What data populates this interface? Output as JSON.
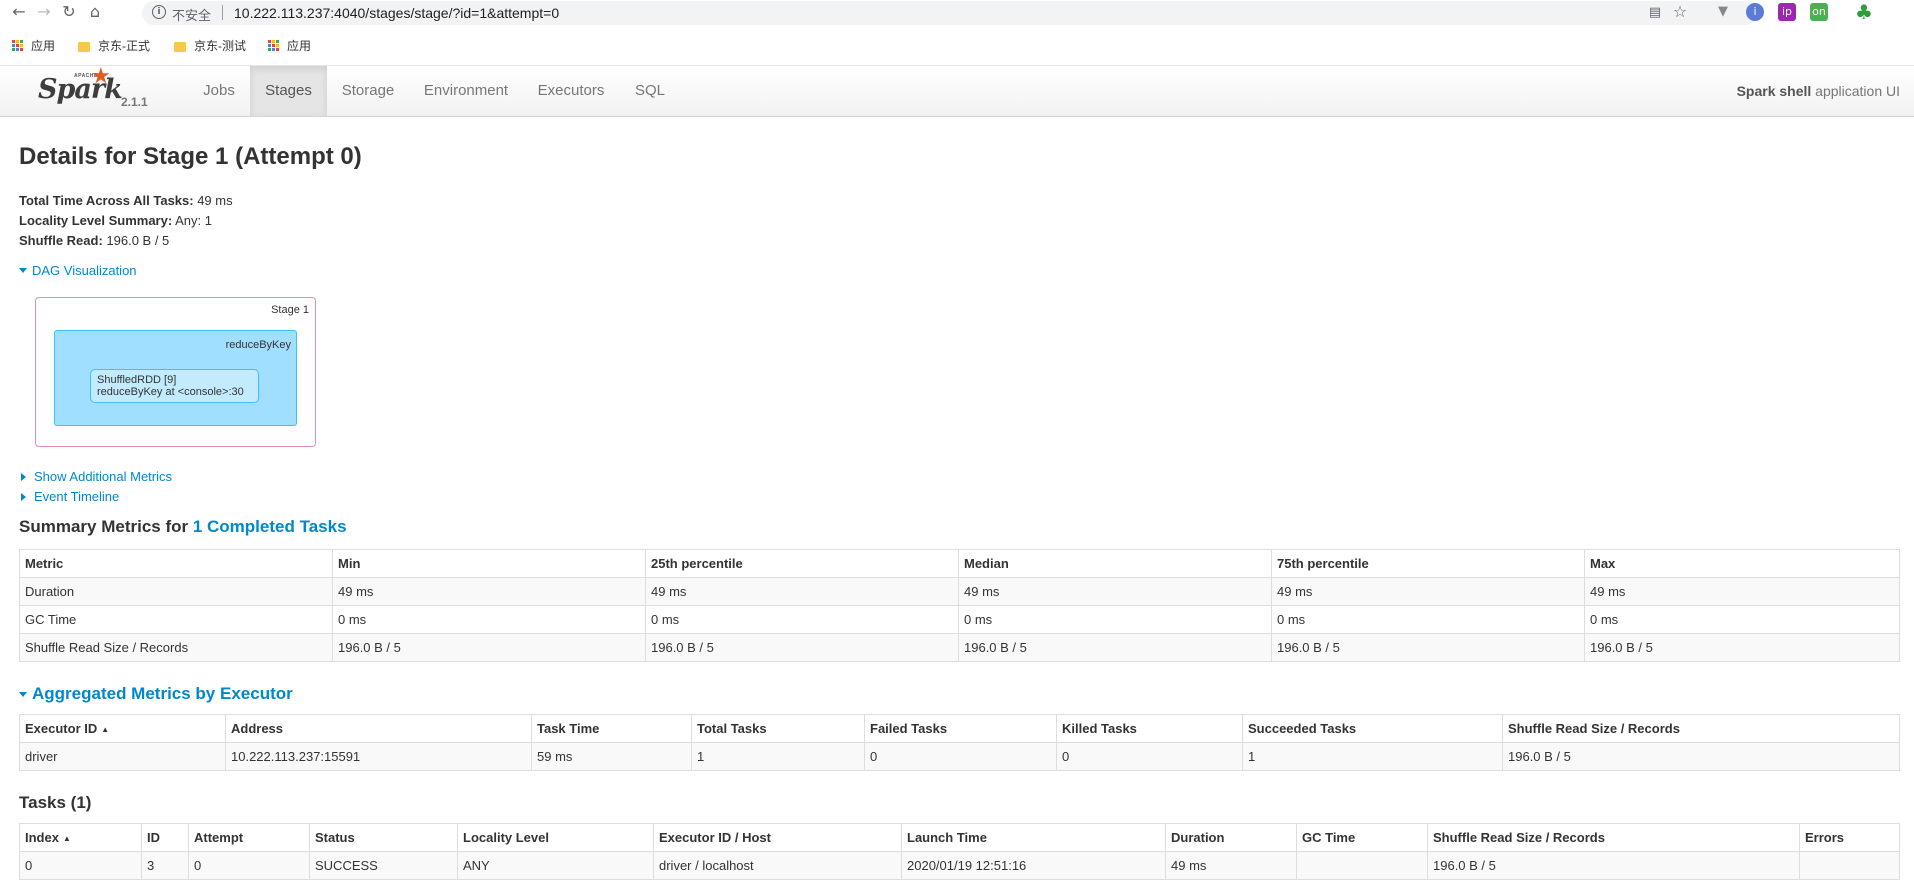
{
  "browser": {
    "insecure_label": "不安全",
    "url": "10.222.113.237:4040/stages/stage/?id=1&attempt=0",
    "bookmarks": [
      "应用",
      "京东-正式",
      "京东-测试",
      "应用"
    ]
  },
  "navbar": {
    "brand_apache": "APACHE",
    "brand_name": "Spark",
    "version": "2.1.1",
    "tabs": [
      "Jobs",
      "Stages",
      "Storage",
      "Environment",
      "Executors",
      "SQL"
    ],
    "active_tab": "Stages",
    "app_name_bold": "Spark shell",
    "app_name_suffix": " application UI"
  },
  "page": {
    "title": "Details for Stage 1 (Attempt 0)",
    "total_time_label": "Total Time Across All Tasks:",
    "total_time_value": " 49 ms",
    "locality_label": "Locality Level Summary:",
    "locality_value": " Any: 1",
    "shuffle_label": "Shuffle Read:",
    "shuffle_value": " 196.0 B / 5",
    "dag_toggle": "DAG Visualization",
    "additional_metrics": "Show Additional Metrics",
    "event_timeline": "Event Timeline"
  },
  "dag": {
    "stage_label": "Stage 1",
    "cluster_label": "reduceByKey",
    "node_line1": "ShuffledRDD [9]",
    "node_line2": "reduceByKey at <console>:30"
  },
  "summary": {
    "heading_prefix": "Summary Metrics for ",
    "heading_link": "1 Completed Tasks",
    "columns": [
      "Metric",
      "Min",
      "25th percentile",
      "Median",
      "75th percentile",
      "Max"
    ],
    "rows": [
      [
        "Duration",
        "49 ms",
        "49 ms",
        "49 ms",
        "49 ms",
        "49 ms"
      ],
      [
        "GC Time",
        "0 ms",
        "0 ms",
        "0 ms",
        "0 ms",
        "0 ms"
      ],
      [
        "Shuffle Read Size / Records",
        "196.0 B / 5",
        "196.0 B / 5",
        "196.0 B / 5",
        "196.0 B / 5",
        "196.0 B / 5"
      ]
    ]
  },
  "executors": {
    "heading": "Aggregated Metrics by Executor",
    "columns": [
      "Executor ID",
      "Address",
      "Task Time",
      "Total Tasks",
      "Failed Tasks",
      "Killed Tasks",
      "Succeeded Tasks",
      "Shuffle Read Size / Records"
    ],
    "rows": [
      [
        "driver",
        "10.222.113.237:15591",
        "59 ms",
        "1",
        "0",
        "0",
        "1",
        "196.0 B / 5"
      ]
    ]
  },
  "tasks": {
    "heading": "Tasks (1)",
    "columns": [
      "Index",
      "ID",
      "Attempt",
      "Status",
      "Locality Level",
      "Executor ID / Host",
      "Launch Time",
      "Duration",
      "GC Time",
      "Shuffle Read Size / Records",
      "Errors"
    ],
    "rows": [
      [
        "0",
        "3",
        "0",
        "SUCCESS",
        "ANY",
        "driver / localhost",
        "2020/01/19 12:51:16",
        "49 ms",
        "",
        "196.0 B / 5",
        ""
      ]
    ]
  }
}
